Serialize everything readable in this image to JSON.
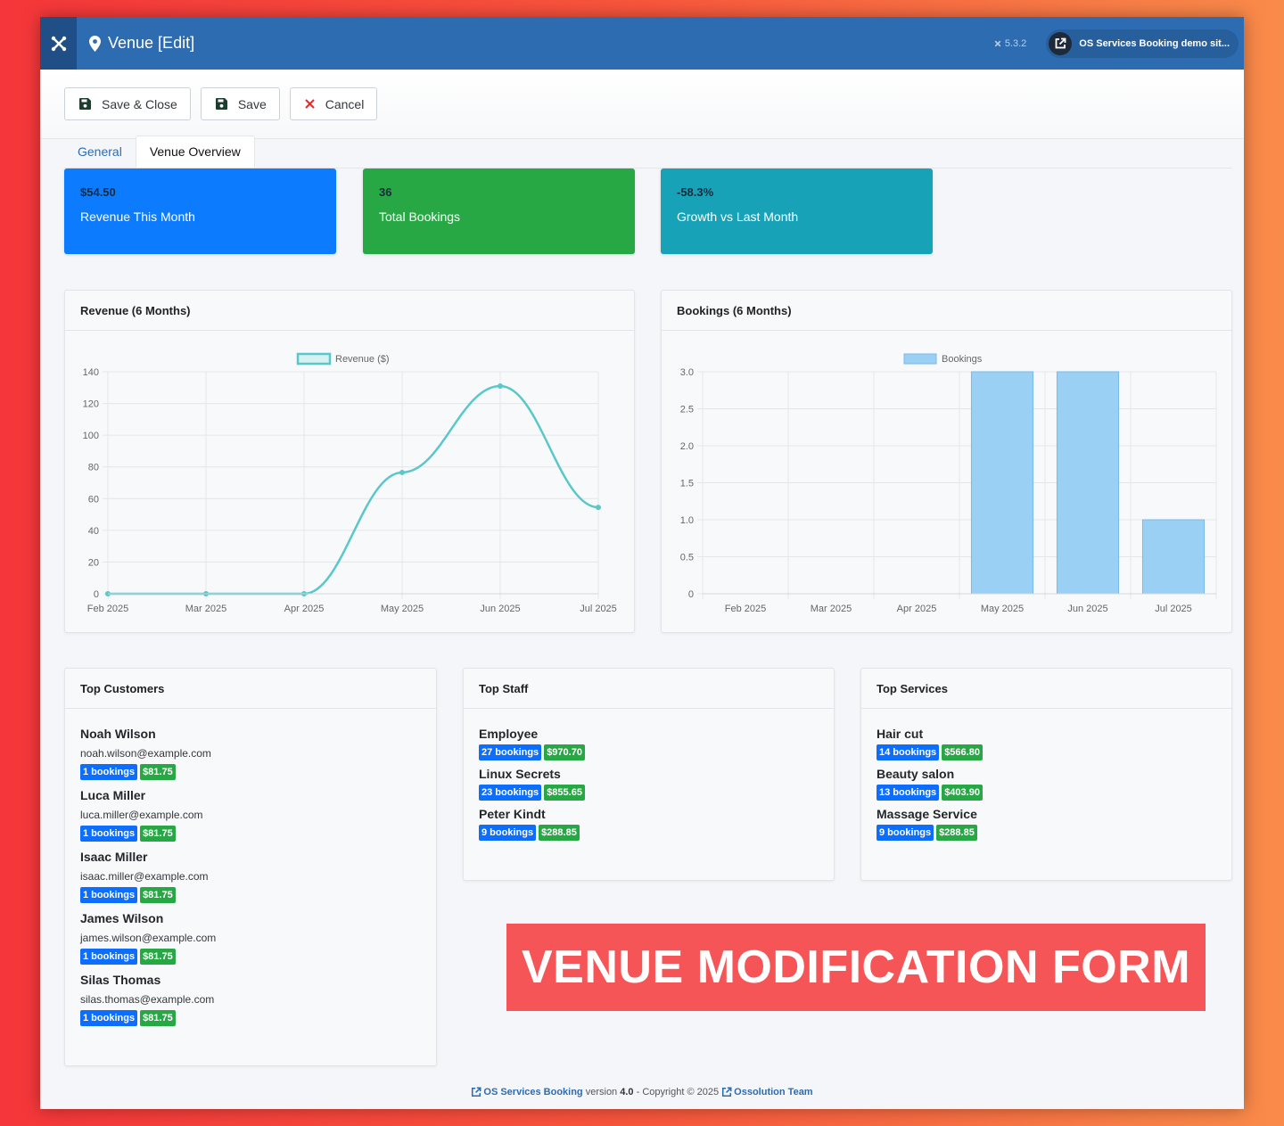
{
  "header": {
    "title": "Venue [Edit]",
    "version": "5.3.2",
    "site_name": "OS Services Booking demo sit..."
  },
  "toolbar": {
    "save_close_label": "Save & Close",
    "save_label": "Save",
    "cancel_label": "Cancel"
  },
  "tabs": [
    {
      "label": "General"
    },
    {
      "label": "Venue Overview"
    }
  ],
  "stats": [
    {
      "value": "$54.50",
      "label": "Revenue This Month",
      "color": "#0d7bfd"
    },
    {
      "value": "36",
      "label": "Total Bookings",
      "color": "#28a745"
    },
    {
      "value": "-58.3%",
      "label": "Growth vs Last Month",
      "color": "#17a2b8"
    }
  ],
  "chart_data": [
    {
      "type": "line",
      "title": "Revenue (6 Months)",
      "categories": [
        "Feb 2025",
        "Mar 2025",
        "Apr 2025",
        "May 2025",
        "Jun 2025",
        "Jul 2025"
      ],
      "series": [
        {
          "name": "Revenue ($)",
          "values": [
            0,
            0,
            0,
            76.5,
            131,
            54.5
          ]
        }
      ],
      "yticks": [
        "0",
        "20",
        "40",
        "60",
        "80",
        "100",
        "120",
        "140"
      ],
      "ylim": [
        0,
        140
      ],
      "grid": true,
      "legend": "top",
      "color": "#5ac8c8"
    },
    {
      "type": "bar",
      "title": "Bookings (6 Months)",
      "categories": [
        "Feb 2025",
        "Mar 2025",
        "Apr 2025",
        "May 2025",
        "Jun 2025",
        "Jul 2025"
      ],
      "series": [
        {
          "name": "Bookings",
          "values": [
            0,
            0,
            0,
            3,
            3,
            1
          ]
        }
      ],
      "yticks": [
        "0",
        "0.5",
        "1.0",
        "1.5",
        "2.0",
        "2.5",
        "3.0"
      ],
      "ylim": [
        0,
        3
      ],
      "grid": true,
      "legend": "top",
      "color": "#9bd0f5"
    }
  ],
  "top_customers": {
    "title": "Top Customers",
    "items": [
      {
        "name": "Noah Wilson",
        "email": "noah.wilson@example.com",
        "bookings": "1 bookings",
        "amount": "$81.75"
      },
      {
        "name": "Luca Miller",
        "email": "luca.miller@example.com",
        "bookings": "1 bookings",
        "amount": "$81.75"
      },
      {
        "name": "Isaac Miller",
        "email": "isaac.miller@example.com",
        "bookings": "1 bookings",
        "amount": "$81.75"
      },
      {
        "name": "James Wilson",
        "email": "james.wilson@example.com",
        "bookings": "1 bookings",
        "amount": "$81.75"
      },
      {
        "name": "Silas Thomas",
        "email": "silas.thomas@example.com",
        "bookings": "1 bookings",
        "amount": "$81.75"
      }
    ]
  },
  "top_staff": {
    "title": "Top Staff",
    "items": [
      {
        "name": "Employee",
        "bookings": "27 bookings",
        "amount": "$970.70"
      },
      {
        "name": "Linux Secrets",
        "bookings": "23 bookings",
        "amount": "$855.65"
      },
      {
        "name": "Peter Kindt",
        "bookings": "9 bookings",
        "amount": "$288.85"
      }
    ]
  },
  "top_services": {
    "title": "Top Services",
    "items": [
      {
        "name": "Hair cut",
        "bookings": "14 bookings",
        "amount": "$566.80"
      },
      {
        "name": "Beauty salon",
        "bookings": "13 bookings",
        "amount": "$403.90"
      },
      {
        "name": "Massage Service",
        "bookings": "9 bookings",
        "amount": "$288.85"
      }
    ]
  },
  "overlay_text": "VENUE MODIFICATION FORM",
  "footer": {
    "product": "OS Services Booking",
    "version_text": "version",
    "version_num": "4.0",
    "copyright": "- Copyright © 2025",
    "team": "Ossolution Team"
  }
}
